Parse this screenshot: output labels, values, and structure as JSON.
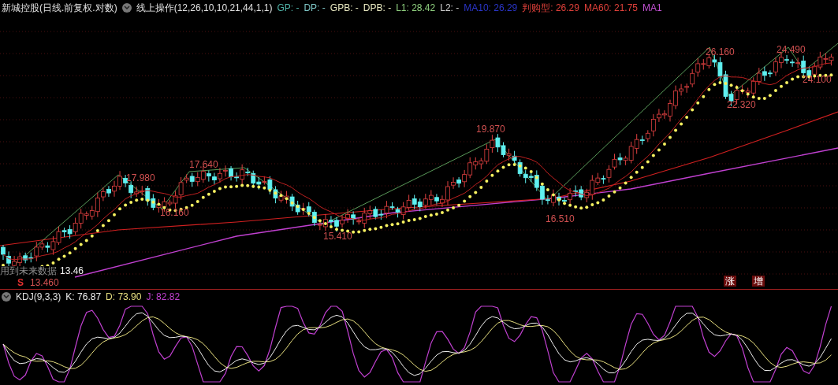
{
  "main_panel": {
    "title": "新城控股(日线.前复权.对数)",
    "indicator": "线上操作(12,26,10,10,21,44,1,1)",
    "readings": [
      {
        "text": "GP: -",
        "color": "#4fb3a8"
      },
      {
        "text": "DP: -",
        "color": "#7fc8c8"
      },
      {
        "text": "GPB: -",
        "color": "#e8e8c0"
      },
      {
        "text": "DPB: -",
        "color": "#e8e8c0"
      },
      {
        "text": "L1: 28.42",
        "color": "#8fd07f"
      },
      {
        "text": "L2: -",
        "color": "#d0d0d0"
      },
      {
        "text": "MA10: 26.29",
        "color": "#2a35c8"
      },
      {
        "text": "判购型: 26.29",
        "color": "#e0403a"
      },
      {
        "text": "MA60: 21.75",
        "color": "#e0403a"
      },
      {
        "text": "MA1",
        "color": "#c050d0"
      }
    ],
    "price_labels": [
      {
        "text": "17.980"
      },
      {
        "text": "17.640"
      },
      {
        "text": "16.160"
      },
      {
        "text": "15.410"
      },
      {
        "text": "19.870"
      },
      {
        "text": "16.510"
      },
      {
        "text": "26.160"
      },
      {
        "text": "22.320"
      },
      {
        "text": "24.490"
      },
      {
        "text": "24.100"
      }
    ],
    "warning": "用到未来数据",
    "last_low": "13.46",
    "low_label": "13.460",
    "signal": "S",
    "badges": [
      "涨",
      "增"
    ]
  },
  "kdj_panel": {
    "title": "KDJ(9,3,3)",
    "readings": [
      {
        "text": "K: 76.87",
        "color": "#f0f0f0"
      },
      {
        "text": "D: 73.90",
        "color": "#e8e080"
      },
      {
        "text": "J: 82.82",
        "color": "#c040d0"
      }
    ]
  }
}
